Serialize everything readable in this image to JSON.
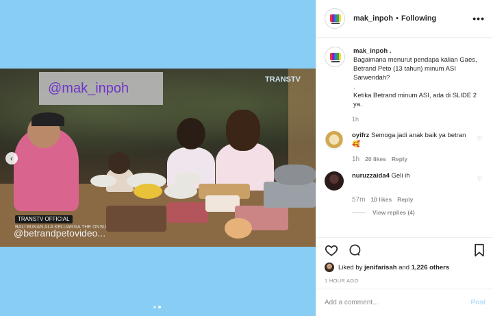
{
  "media": {
    "watermark": "@mak_inpoh",
    "channel_logo": "TRANSTV",
    "badge": "TRANSTV OFFICIAL",
    "subtitle": "BALI BUKAN ALA KELUARGA THE ONSU",
    "overlay_handle": "@betrandpetovideo..."
  },
  "header": {
    "username": "mak_inpoh",
    "separator": "•",
    "follow_state": "Following",
    "more": "•••"
  },
  "caption": {
    "username": "mak_inpoh .",
    "text": "Bagaimana menurut pendapa kalian Gaes, Betrand Peto (13 tahun) minum ASI Sarwendah?\n.\nKetika Betrand minum ASI, ada di SLIDE 2 ya.",
    "time": "1h"
  },
  "comments": [
    {
      "username": "oyifrz",
      "text": "Semoga jadi anak baik ya betran 🥰",
      "time": "1h",
      "likes": "20 likes",
      "reply": "Reply"
    },
    {
      "username": "nuruzzaida4",
      "text": "Geli ih",
      "time": "57m",
      "likes": "10 likes",
      "reply": "Reply",
      "view_replies": "View replies (4)"
    }
  ],
  "likes": {
    "prefix": "Liked by",
    "user": "jenifarisah",
    "and": "and",
    "others": "1,226 others"
  },
  "posted": "1 HOUR AGO",
  "add_comment": {
    "placeholder": "Add a comment...",
    "post_label": "Post"
  },
  "icons": {
    "like": "heart-icon",
    "comment": "comment-icon",
    "save": "bookmark-icon"
  },
  "carousel": {
    "slides": 2,
    "current": 2
  }
}
